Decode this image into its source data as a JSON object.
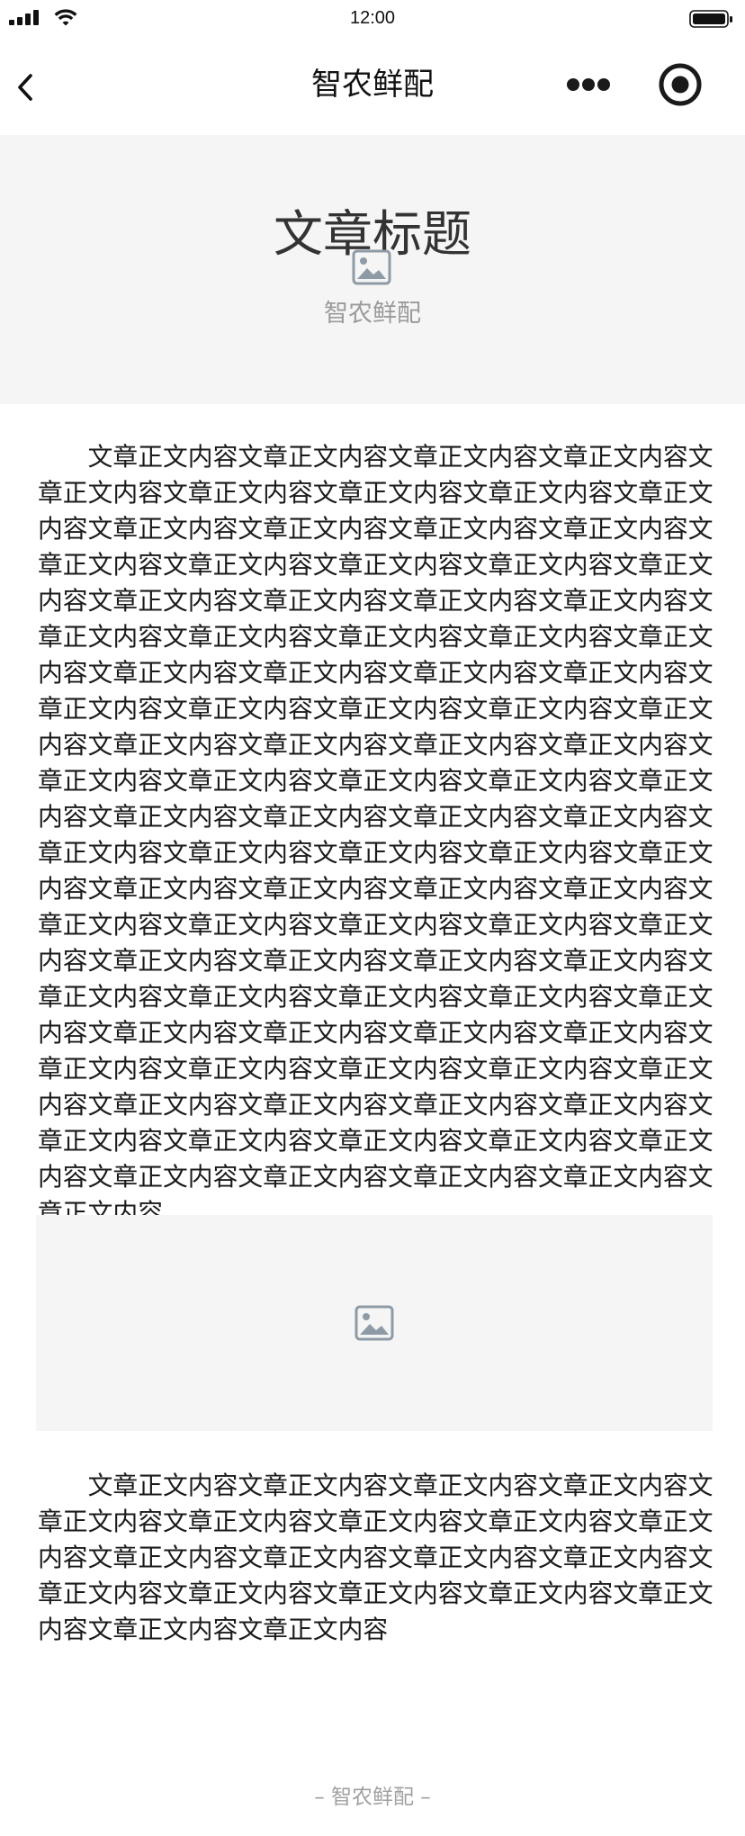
{
  "status_bar": {
    "time": "12:00",
    "icons": [
      "signal-icon",
      "wifi-icon",
      "battery-icon"
    ]
  },
  "nav": {
    "title": "智农鲜配",
    "back_icon": "chevron-left-icon",
    "more_icon": "more-dots-icon",
    "close_icon": "target-icon"
  },
  "banner": {
    "title": "文章标题",
    "icon": "image-placeholder-icon",
    "caption": "智农鲜配"
  },
  "article": {
    "paragraphs": [
      "文章正文内容文章正文内容文章正文内容文章正文内容文章正文内容文章正文内容文章正文内容文章正文内容文章正文内容文章正文内容文章正文内容文章正文内容文章正文内容文章正文内容文章正文内容文章正文内容文章正文内容文章正文内容文章正文内容文章正文内容文章正文内容文章正文内容文章正文内容文章正文内容文章正文内容文章正文内容文章正文内容文章正文内容文章正文内容文章正文内容文章正文内容文章正文内容文章正文内容文章正文内容文章正文内容文章正文内容文章正文内容文章正文内容文章正文内容文章正文内容文章正文内容文章正文内容文章正文内容文章正文内容文章正文内容文章正文内容文章正文内容文章正文内容文章正文内容文章正文内容文章正文内容文章正文内容文章正文内容文章正文内容文章正文内容文章正文内容文章正文内容文章正文内容文章正文内容文章正文内容文章正文内容文章正文内容文章正文内容文章正文内容文章正文内容文章正文内容文章正文内容文章正文内容文章正文内容文章正文内容文章正文内容文章正文内容文章正文内容文章正文内容文章正文内容文章正文内容文章正文内容文章正文内容文章正文内容文章正文内容文章正文内容文章正文内容文章正文内容文章正文内容文章正文内容文章正文内容文章正文内容文章正文内容文章正文内容文章正文内容文章正文内容文章正文内容文章正文内容文章正文内容文章正文内容",
      "文章正文内容文章正文内容文章正文内容文章正文内容文章正文内容文章正文内容文章正文内容文章正文内容文章正文内容文章正文内容文章正文内容文章正文内容文章正文内容文章正文内容文章正文内容文章正文内容文章正文内容文章正文内容文章正文内容文章正文内容"
    ],
    "image_icon": "image-placeholder-icon"
  },
  "footer": {
    "text": "– 智农鲜配 –"
  },
  "colors": {
    "banner_bg": "#f5f5f5",
    "image_bg": "#f5f5f5",
    "body_text": "#1a1a1a",
    "muted_text": "#9a9a9a",
    "icon_gray": "#8e9ba7"
  }
}
